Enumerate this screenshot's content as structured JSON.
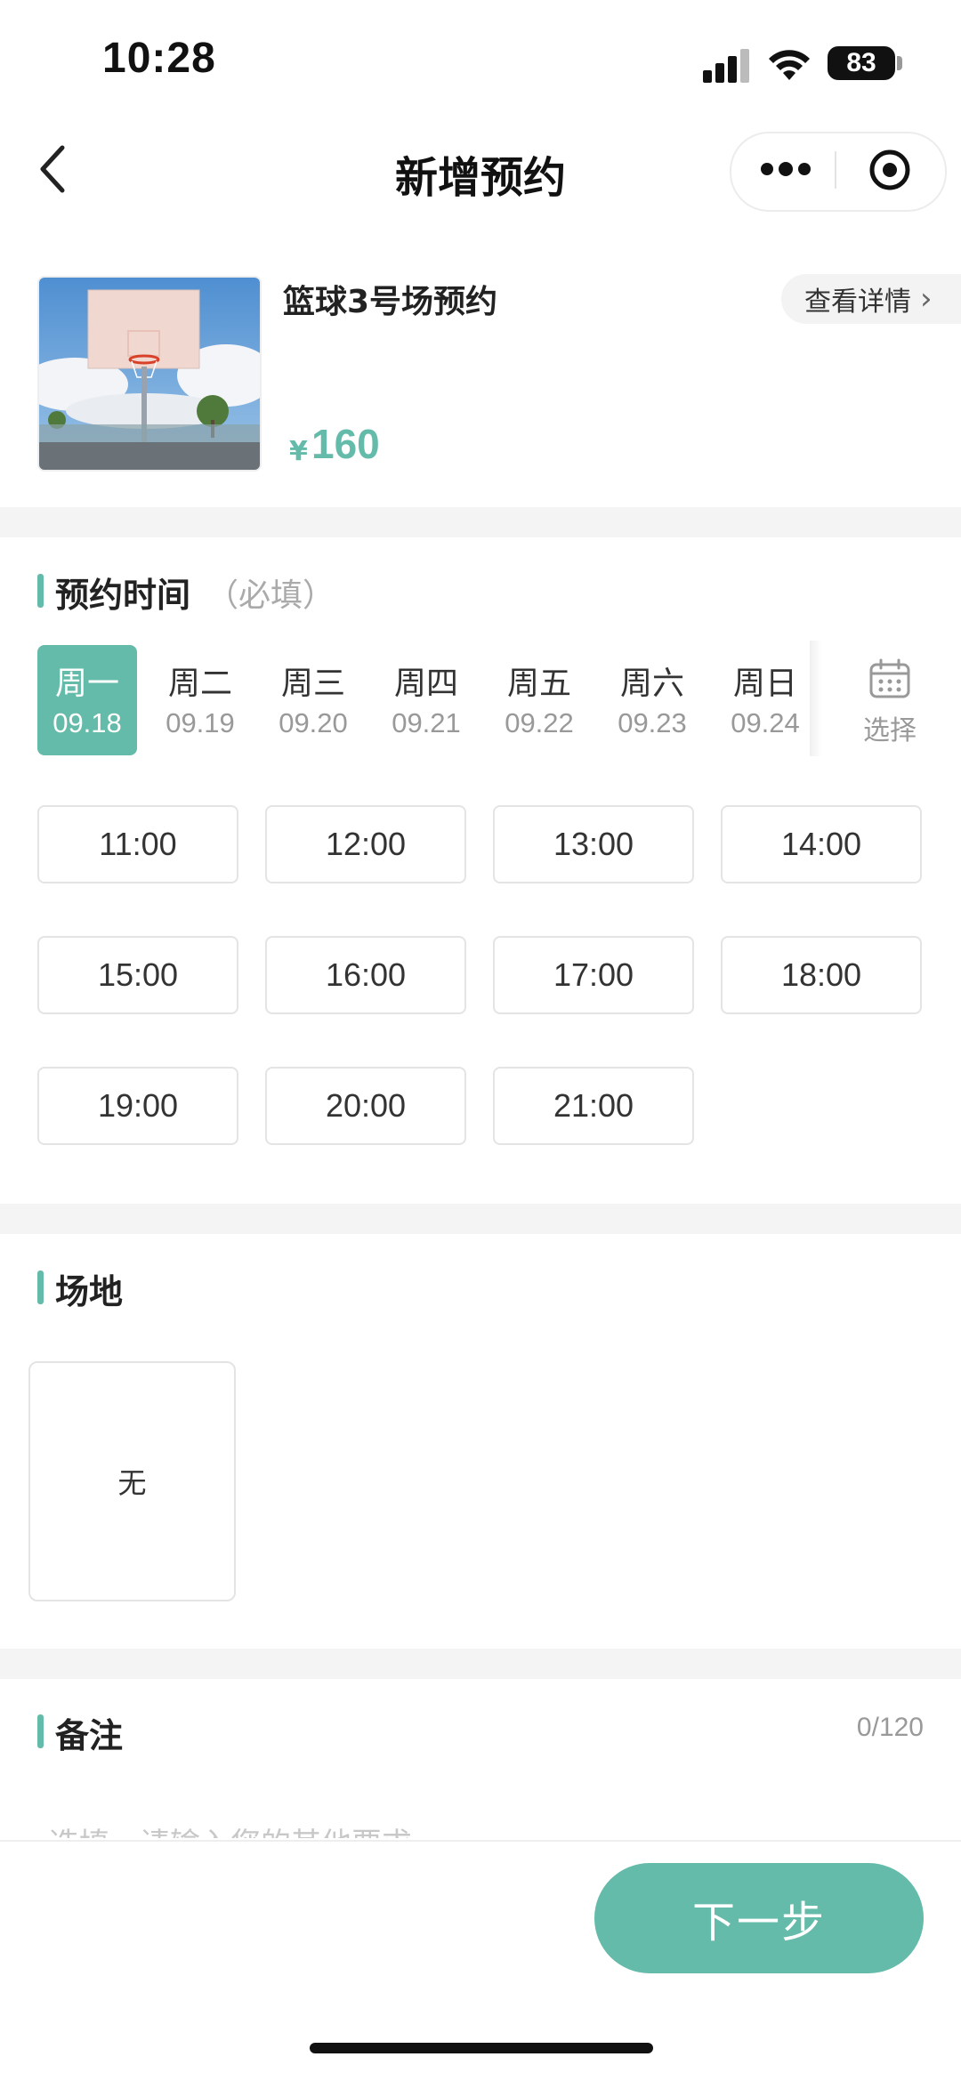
{
  "status_bar": {
    "time": "10:28",
    "battery": "83"
  },
  "nav": {
    "title": "新增预约"
  },
  "product": {
    "name": "篮球3号场预约",
    "currency": "¥",
    "price": "160",
    "detail_label": "查看详情"
  },
  "booking_time": {
    "title": "预约时间",
    "subtitle": "（必填）",
    "days": [
      {
        "weekday": "周一",
        "date": "09.18",
        "selected": true
      },
      {
        "weekday": "周二",
        "date": "09.19",
        "selected": false
      },
      {
        "weekday": "周三",
        "date": "09.20",
        "selected": false
      },
      {
        "weekday": "周四",
        "date": "09.21",
        "selected": false
      },
      {
        "weekday": "周五",
        "date": "09.22",
        "selected": false
      },
      {
        "weekday": "周六",
        "date": "09.23",
        "selected": false
      },
      {
        "weekday": "周日",
        "date": "09.24",
        "selected": false
      }
    ],
    "pick_label": "选择",
    "slots": [
      "11:00",
      "12:00",
      "13:00",
      "14:00",
      "15:00",
      "16:00",
      "17:00",
      "18:00",
      "19:00",
      "20:00",
      "21:00"
    ]
  },
  "venue": {
    "title": "场地",
    "option": "无"
  },
  "remark": {
    "title": "备注",
    "counter": "0/120",
    "placeholder": "选填，请输入您的其他要求"
  },
  "footer": {
    "next_label": "下一步"
  },
  "colors": {
    "accent": "#64bba9",
    "separator": "#f4f4f4"
  }
}
